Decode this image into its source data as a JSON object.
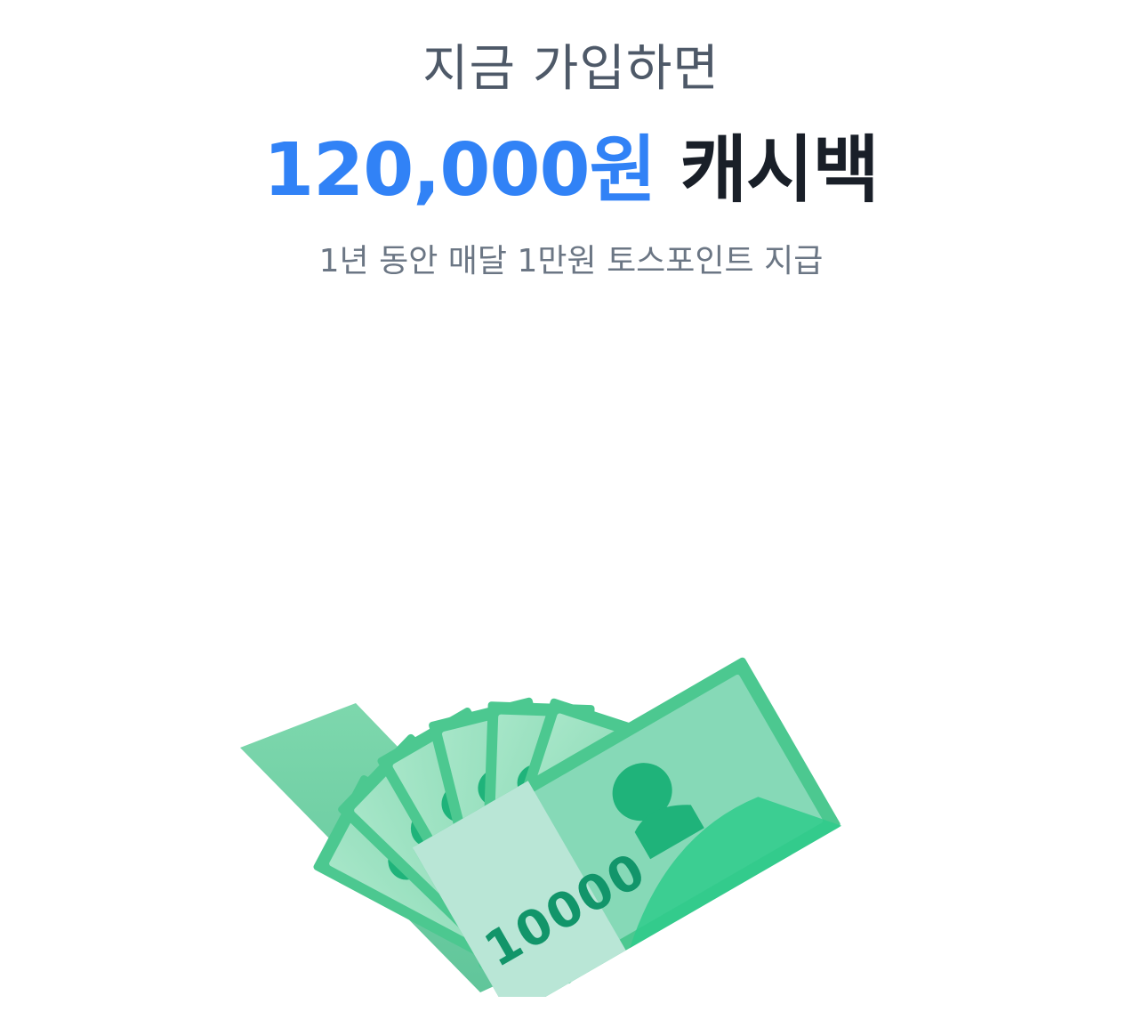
{
  "promo": {
    "headline": "지금 가입하면",
    "amount": "120,000원",
    "suffix": "캐시백",
    "subtext": "1년 동안 매달 1만원 토스포인트 지급"
  },
  "illustration": {
    "icon": "banknote-fan-illustration",
    "note_value": "10000",
    "colors": {
      "bill_dark": "#3fc58e",
      "bill_light": "#8fdcb8",
      "bill_band": "#b9e6d6",
      "portrait": "#1fb37a",
      "number": "#12956a"
    }
  }
}
